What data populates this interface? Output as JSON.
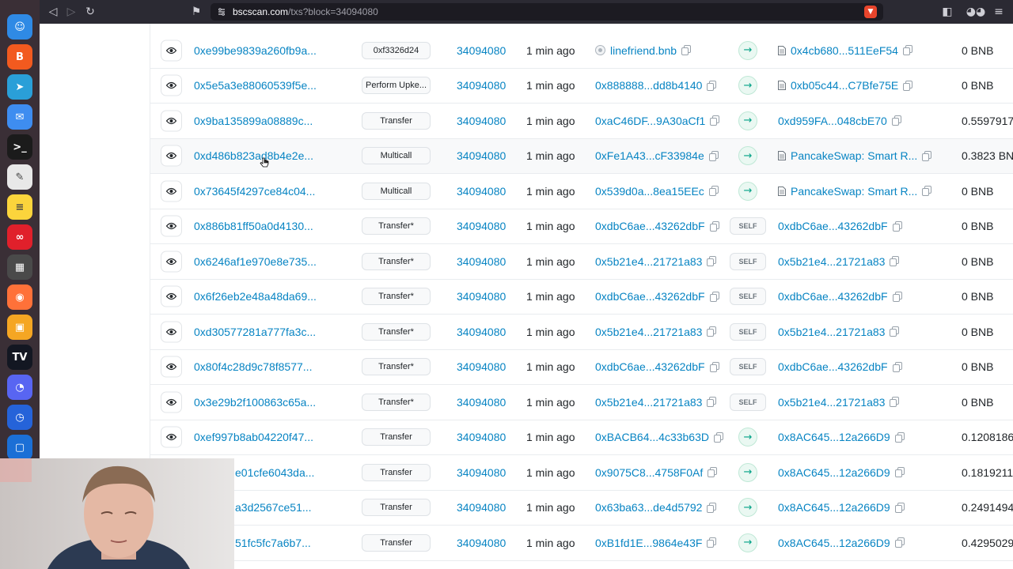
{
  "browser": {
    "url_host": "bscscan.com",
    "url_path": "/txs?block=34094080"
  },
  "dock": {
    "apps": [
      {
        "name": "finder-icon",
        "color": "#2f8ae5",
        "glyph": "☺"
      },
      {
        "name": "brave-icon",
        "color": "#f25a1f",
        "glyph": "B"
      },
      {
        "name": "telegram-icon",
        "color": "#2a9fd8",
        "glyph": "➤"
      },
      {
        "name": "mail-icon",
        "color": "#3e8df0",
        "glyph": "✉"
      },
      {
        "name": "terminal-icon",
        "color": "#1b1b1b",
        "glyph": ">_"
      },
      {
        "name": "textedit-icon",
        "color": "#e8e8e8",
        "glyph": "✎"
      },
      {
        "name": "notes-icon",
        "color": "#fbd43c",
        "glyph": "≡"
      },
      {
        "name": "acrobat-icon",
        "color": "#e0202b",
        "glyph": "∞"
      },
      {
        "name": "calculator-icon",
        "color": "#4a4a4a",
        "glyph": "▦"
      },
      {
        "name": "firefox-icon",
        "color": "#ff7139",
        "glyph": "◉"
      },
      {
        "name": "qr-app-icon",
        "color": "#f5a623",
        "glyph": "▣"
      },
      {
        "name": "tradingview-icon",
        "color": "#131722",
        "glyph": "TV"
      },
      {
        "name": "discord-icon",
        "color": "#5865f2",
        "glyph": "◔"
      },
      {
        "name": "clock-icon",
        "color": "#2563d9",
        "glyph": "◷"
      },
      {
        "name": "app-icon",
        "color": "#1b6fd6",
        "glyph": "▢"
      }
    ]
  },
  "transactions": [
    {
      "hash": "0xe99be9839a260fb9a...",
      "method": "0xf3326d24",
      "block": "34094080",
      "age": "1 min ago",
      "from": "linefriend.bnb",
      "from_badge": true,
      "dir": "in",
      "to": "0x4cb680...511EeF54",
      "to_contract": true,
      "value": "0 BNB"
    },
    {
      "hash": "0x5e5a3e88060539f5e...",
      "method": "Perform Upke...",
      "block": "34094080",
      "age": "1 min ago",
      "from": "0x888888...dd8b4140",
      "dir": "in",
      "to": "0xb05c44...C7Bfe75E",
      "to_contract": true,
      "value": "0 BNB"
    },
    {
      "hash": "0x9ba135899a08889c...",
      "method": "Transfer",
      "block": "34094080",
      "age": "1 min ago",
      "from": "0xaC46DF...9A30aCf1",
      "dir": "in",
      "to": "0xd959FA...048cbE70",
      "value": "0.5597917"
    },
    {
      "hash": "0xd486b823ad8b4e2e...",
      "method": "Multicall",
      "block": "34094080",
      "age": "1 min ago",
      "from": "0xFe1A43...cF33984e",
      "dir": "in",
      "to": "PancakeSwap: Smart R...",
      "to_contract": true,
      "value": "0.3823 BN"
    },
    {
      "hash": "0x73645f4297ce84c04...",
      "method": "Multicall",
      "block": "34094080",
      "age": "1 min ago",
      "from": "0x539d0a...8ea15EEc",
      "dir": "in",
      "to": "PancakeSwap: Smart R...",
      "to_contract": true,
      "value": "0 BNB"
    },
    {
      "hash": "0x886b81ff50a0d4130...",
      "method": "Transfer*",
      "block": "34094080",
      "age": "1 min ago",
      "from": "0xdbC6ae...43262dbF",
      "dir": "self",
      "to": "0xdbC6ae...43262dbF",
      "value": "0 BNB"
    },
    {
      "hash": "0x6246af1e970e8e735...",
      "method": "Transfer*",
      "block": "34094080",
      "age": "1 min ago",
      "from": "0x5b21e4...21721a83",
      "dir": "self",
      "to": "0x5b21e4...21721a83",
      "value": "0 BNB"
    },
    {
      "hash": "0x6f26eb2e48a48da69...",
      "method": "Transfer*",
      "block": "34094080",
      "age": "1 min ago",
      "from": "0xdbC6ae...43262dbF",
      "dir": "self",
      "to": "0xdbC6ae...43262dbF",
      "value": "0 BNB"
    },
    {
      "hash": "0xd30577281a777fa3c...",
      "method": "Transfer*",
      "block": "34094080",
      "age": "1 min ago",
      "from": "0x5b21e4...21721a83",
      "dir": "self",
      "to": "0x5b21e4...21721a83",
      "value": "0 BNB"
    },
    {
      "hash": "0x80f4c28d9c78f8577...",
      "method": "Transfer*",
      "block": "34094080",
      "age": "1 min ago",
      "from": "0xdbC6ae...43262dbF",
      "dir": "self",
      "to": "0xdbC6ae...43262dbF",
      "value": "0 BNB"
    },
    {
      "hash": "0x3e29b2f100863c65a...",
      "method": "Transfer*",
      "block": "34094080",
      "age": "1 min ago",
      "from": "0x5b21e4...21721a83",
      "dir": "self",
      "to": "0x5b21e4...21721a83",
      "value": "0 BNB"
    },
    {
      "hash": "0xef997b8ab04220f47...",
      "method": "Transfer",
      "block": "34094080",
      "age": "1 min ago",
      "from": "0xBACB64...4c33b63D",
      "dir": "in",
      "to": "0x8AC645...12a266D9",
      "value": "0.1208186"
    },
    {
      "hash": "e01cfe6043da...",
      "method": "Transfer",
      "block": "34094080",
      "age": "1 min ago",
      "from": "0x9075C8...4758F0Af",
      "dir": "in",
      "to": "0x8AC645...12a266D9",
      "value": "0.1819211"
    },
    {
      "hash": "a3d2567ce51...",
      "method": "Transfer",
      "block": "34094080",
      "age": "1 min ago",
      "from": "0x63ba63...de4d5792",
      "dir": "in",
      "to": "0x8AC645...12a266D9",
      "value": "0.2491494"
    },
    {
      "hash": "51fc5fc7a6b7...",
      "method": "Transfer",
      "block": "34094080",
      "age": "1 min ago",
      "from": "0xB1fd1E...9864e43F",
      "dir": "in",
      "to": "0x8AC645...12a266D9",
      "value": "0.4295029"
    }
  ],
  "self_label": "SELF",
  "colors": {
    "link": "#0784c3",
    "in_arrow": "#00a186",
    "dock": "#3a2f36",
    "toolbar": "#2b2a33"
  }
}
